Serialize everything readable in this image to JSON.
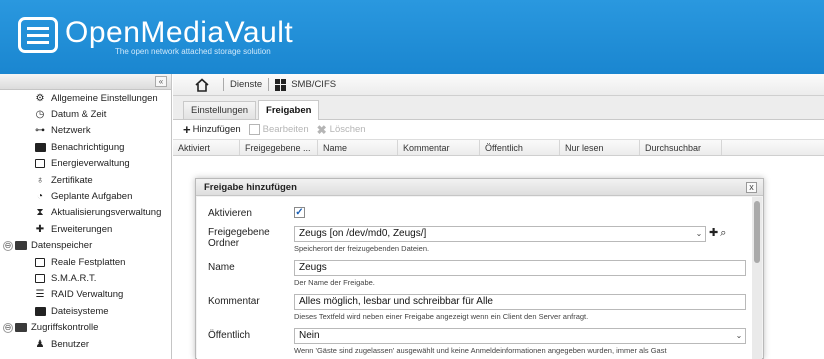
{
  "app": {
    "title": "OpenMediaVault",
    "subtitle": "The open network attached storage solution"
  },
  "tree": {
    "collapse_symbol": "«",
    "items": [
      {
        "label": "Allgemeine Einstellungen",
        "icon": "gears-icon"
      },
      {
        "label": "Datum & Zeit",
        "icon": "clock-icon"
      },
      {
        "label": "Netzwerk",
        "icon": "network-icon"
      },
      {
        "label": "Benachrichtigung",
        "icon": "mail-icon"
      },
      {
        "label": "Energieverwaltung",
        "icon": "power-icon"
      },
      {
        "label": "Zertifikate",
        "icon": "certificate-icon"
      },
      {
        "label": "Geplante Aufgaben",
        "icon": "scheduled-tasks-icon"
      },
      {
        "label": "Aktualisierungsverwaltung",
        "icon": "update-icon"
      },
      {
        "label": "Erweiterungen",
        "icon": "plugin-icon"
      }
    ],
    "sections": [
      {
        "label": "Datenspeicher",
        "toggle": "⊖",
        "items": [
          {
            "label": "Reale Festplatten"
          },
          {
            "label": "S.M.A.R.T."
          },
          {
            "label": "RAID Verwaltung"
          },
          {
            "label": "Dateisysteme"
          }
        ]
      },
      {
        "label": "Zugriffskontrolle",
        "toggle": "⊖",
        "items": [
          {
            "label": "Benutzer"
          }
        ]
      }
    ]
  },
  "breadcrumb": {
    "items": [
      "Dienste",
      "SMB/CIFS"
    ]
  },
  "tabs": [
    {
      "label": "Einstellungen",
      "active": false
    },
    {
      "label": "Freigaben",
      "active": true
    }
  ],
  "toolbar": {
    "add": "Hinzufügen",
    "edit": "Bearbeiten",
    "delete": "Löschen"
  },
  "grid": {
    "columns": [
      "Aktiviert",
      "Freigegebene ...",
      "Name",
      "Kommentar",
      "Öffentlich",
      "Nur lesen",
      "Durchsuchbar"
    ]
  },
  "dialog": {
    "title": "Freigabe hinzufügen",
    "close": "x",
    "fields": {
      "enable": {
        "label": "Aktivieren",
        "checked": true
      },
      "folder": {
        "label": "Freigegebene Ordner",
        "value": "Zeugs [on /dev/md0, Zeugs/]",
        "hint": "Speicherort der freizugebenden Dateien."
      },
      "name": {
        "label": "Name",
        "value": "Zeugs",
        "hint": "Der Name der Freigabe."
      },
      "comment": {
        "label": "Kommentar",
        "value": "Alles möglich, lesbar und schreibbar für Alle",
        "hint": "Dieses Textfeld wird neben einer Freigabe angezeigt wenn ein Client den Server anfragt."
      },
      "public": {
        "label": "Öffentlich",
        "value": "Nein",
        "hint": "Wenn 'Gäste sind zugelassen' ausgewählt und keine Anmeldeinformationen angegeben wurden, immer als Gast"
      }
    }
  }
}
